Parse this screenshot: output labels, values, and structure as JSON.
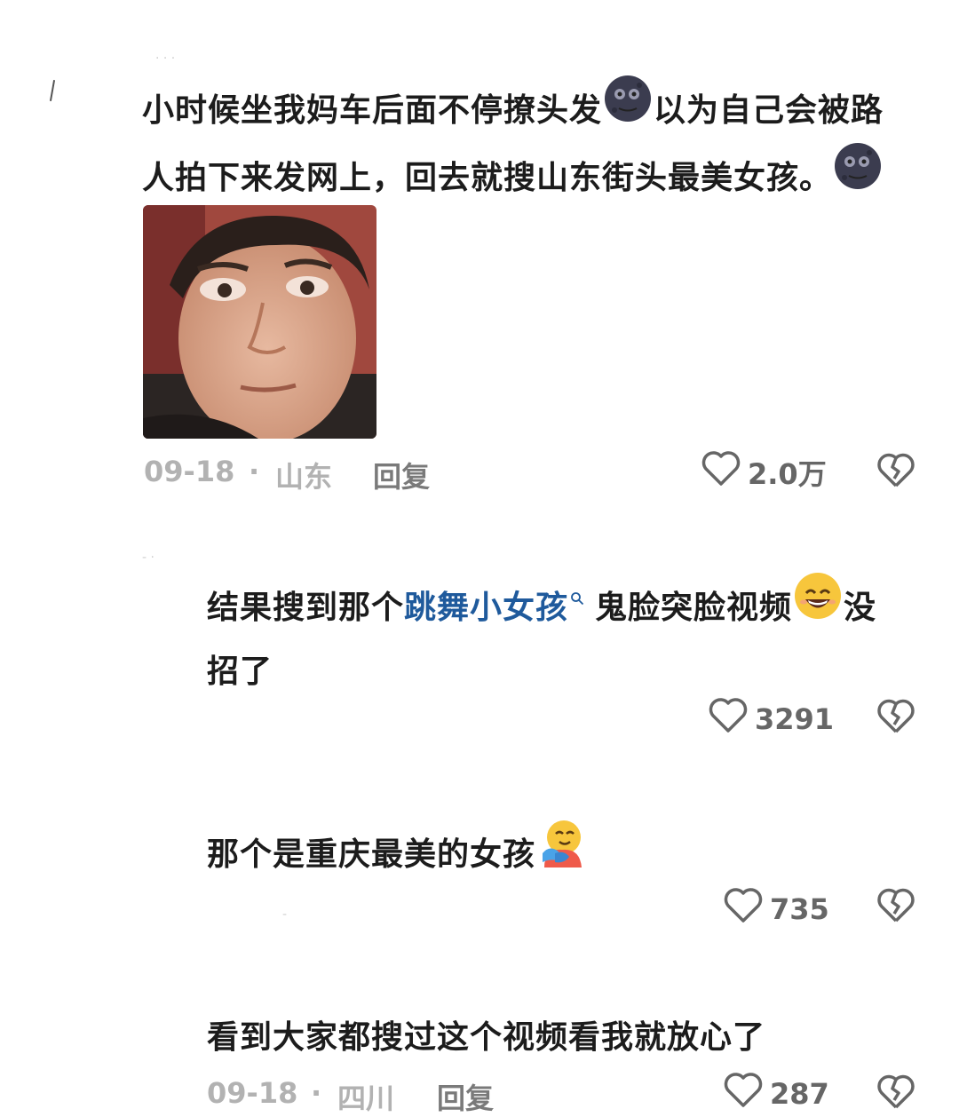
{
  "comments": [
    {
      "text_line1_a": "小时候坐我妈车后面不停撩头发",
      "text_line1_b": "以为自己会被路",
      "text_line2": "人拍下来发网上，回去就搜山东街头最美女孩。",
      "emoji": "moon-face-emoji",
      "date": "09-18",
      "sep": "·",
      "location": "山东",
      "reply_label": "回复",
      "likes": "2.0万"
    },
    {
      "text_a": "结果搜到那个",
      "search_link": "跳舞小女孩",
      "text_b": "鬼脸突脸视频",
      "text_c": "没",
      "text_line2": "招了",
      "emoji": "grinning-sweat-emoji",
      "likes": "3291"
    },
    {
      "text": "那个是重庆最美的女孩",
      "emoji": "hugging-face-emoji",
      "likes": "735"
    },
    {
      "text": "看到大家都搜过这个视频看我就放心了",
      "date": "09-18",
      "sep": "·",
      "location": "四川",
      "reply_label": "回复",
      "likes": "287"
    }
  ],
  "icons": {
    "like": "heart-outline-icon",
    "dislike": "broken-heart-icon",
    "search": "search-icon"
  },
  "colors": {
    "link": "#1f5a9c",
    "meta": "#b2b2b2",
    "text": "#1c1c1c"
  }
}
